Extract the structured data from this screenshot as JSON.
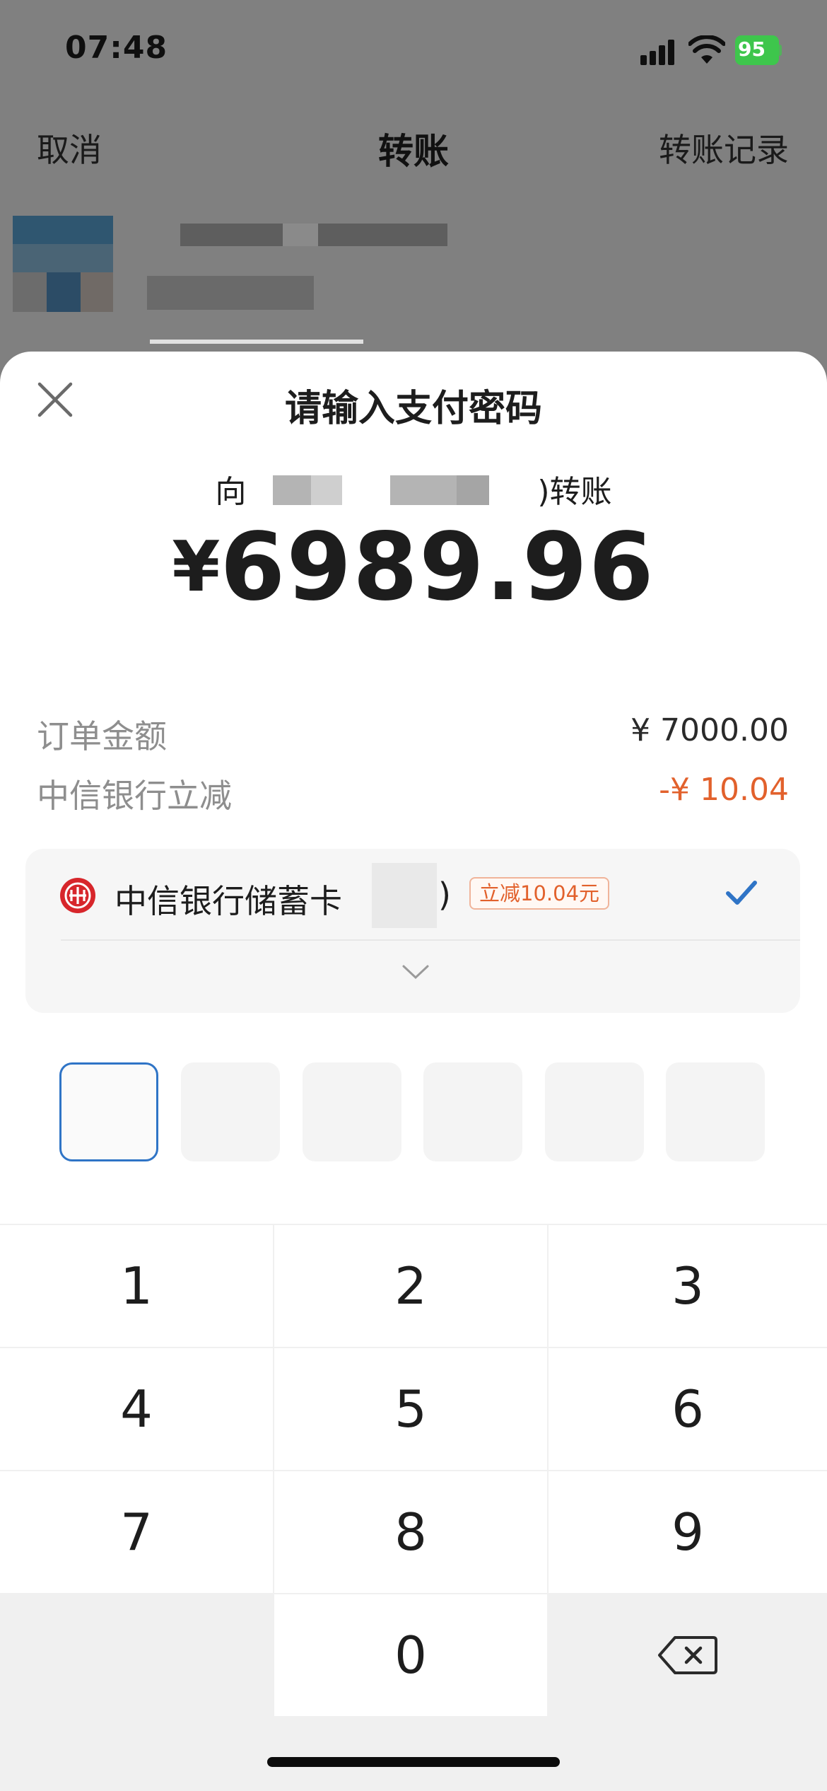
{
  "status_bar": {
    "time": "07:48",
    "battery": "95"
  },
  "nav": {
    "cancel": "取消",
    "title": "转账",
    "history": "转账记录"
  },
  "sheet": {
    "title": "请输入支付密码",
    "payee_prefix": "向",
    "payee_suffix": ")转账",
    "amount_currency": "¥",
    "amount_value": "6989.96",
    "order_amount_label": "订单金额",
    "order_amount_value": "¥ 7000.00",
    "discount_label": "中信银行立减",
    "discount_value": "-¥ 10.04"
  },
  "payment_method": {
    "bank_name": "中信银行储蓄卡",
    "card_suffix": ")",
    "promo_tag": "立减10.04元"
  },
  "pin": {
    "length": 6,
    "filled": 0,
    "active_index": 0
  },
  "keypad": {
    "keys": [
      "1",
      "2",
      "3",
      "4",
      "5",
      "6",
      "7",
      "8",
      "9",
      "",
      "0",
      "delete"
    ]
  },
  "colors": {
    "accent_blue": "#2f74c6",
    "discount_orange": "#e2612c",
    "battery_green": "#3ec64c",
    "bank_red": "#d7262b"
  },
  "icons": [
    "close-icon",
    "citic-bank-logo-icon",
    "checkmark-icon",
    "chevron-down-icon",
    "delete-key-icon",
    "signal-icon",
    "wifi-icon",
    "battery-icon"
  ]
}
